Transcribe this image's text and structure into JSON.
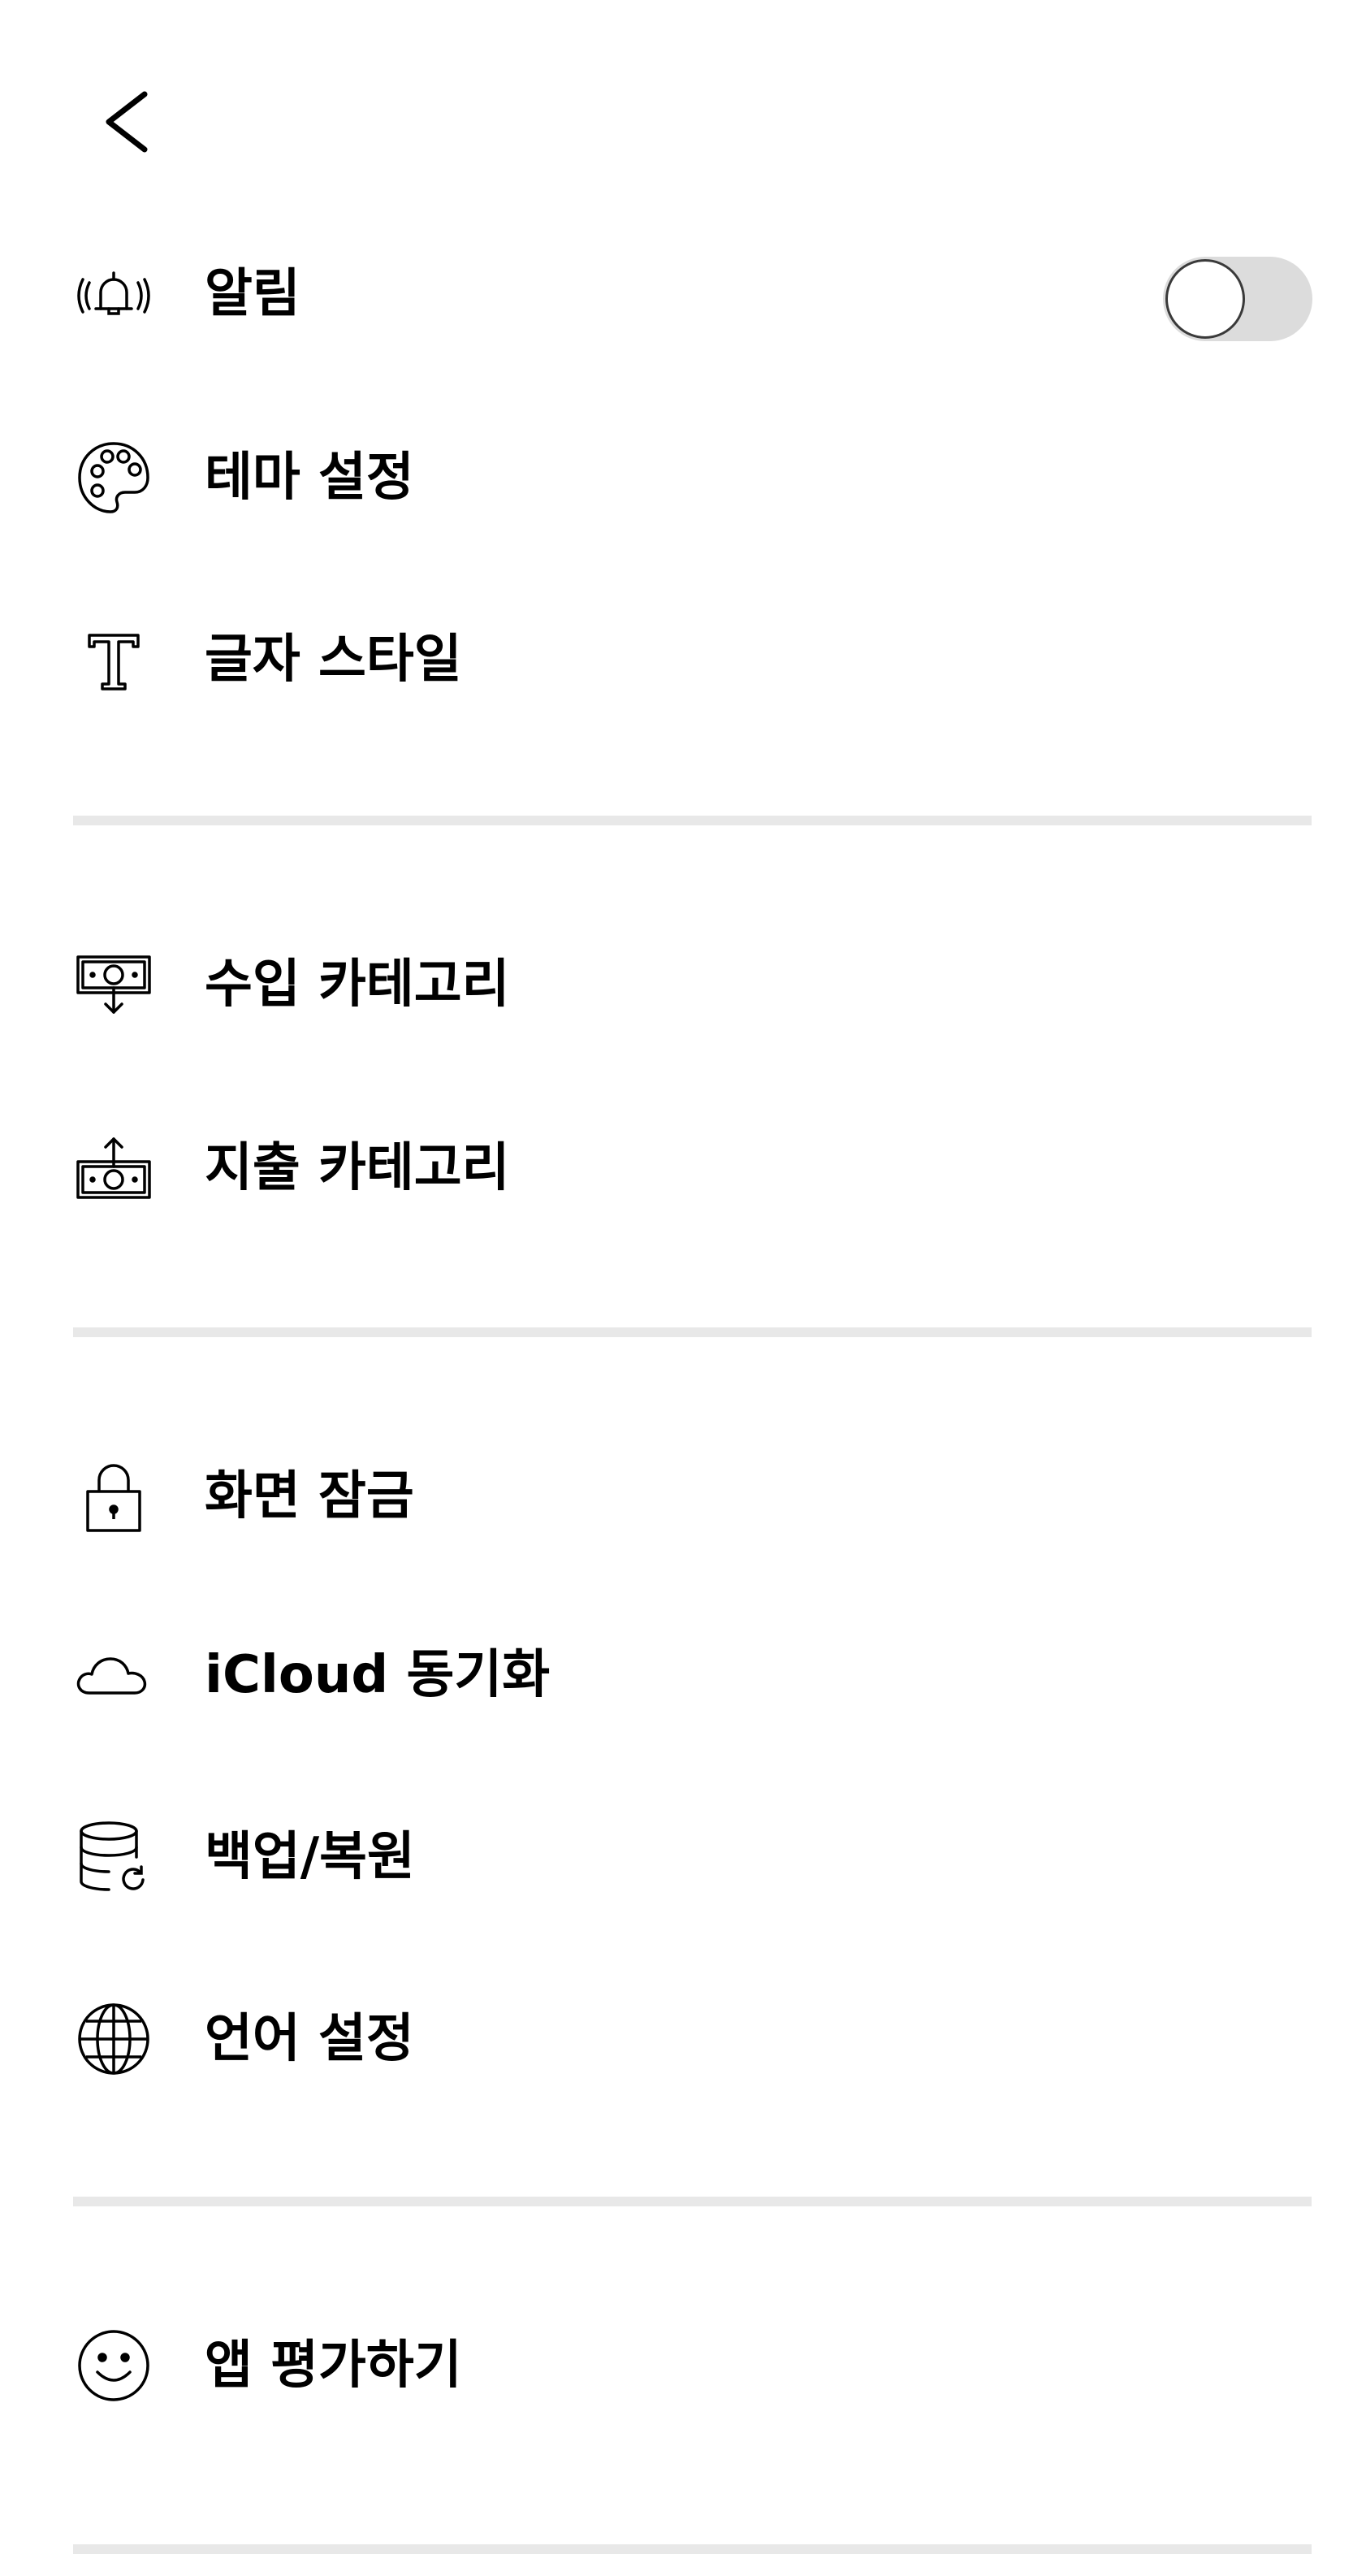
{
  "nav": {
    "back_icon": "chevron-left-icon"
  },
  "sections": {
    "display": {
      "notifications": {
        "label": "알림",
        "icon": "bell-ringing-icon",
        "toggle_on": false
      },
      "theme": {
        "label": "테마 설정",
        "icon": "palette-icon"
      },
      "font_style": {
        "label": "글자 스타일",
        "icon": "text-t-icon"
      }
    },
    "categories": {
      "income": {
        "label": "수입 카테고리",
        "icon": "money-in-icon"
      },
      "expense": {
        "label": "지출 카테고리",
        "icon": "money-out-icon"
      }
    },
    "data": {
      "screen_lock": {
        "label": "화면 잠금",
        "icon": "lock-icon"
      },
      "icloud_sync": {
        "label": "iCloud 동기화",
        "icon": "cloud-icon"
      },
      "backup_restore": {
        "label": "백업/복원",
        "icon": "database-refresh-icon"
      },
      "language": {
        "label": "언어 설정",
        "icon": "globe-icon"
      }
    },
    "feedback": {
      "rate_app": {
        "label": "앱 평가하기",
        "icon": "smiley-icon"
      }
    }
  },
  "colors": {
    "text": "#000000",
    "divider": "#e8e8e8",
    "toggle_track_off": "#dcdcdc",
    "toggle_knob": "#ffffff"
  }
}
